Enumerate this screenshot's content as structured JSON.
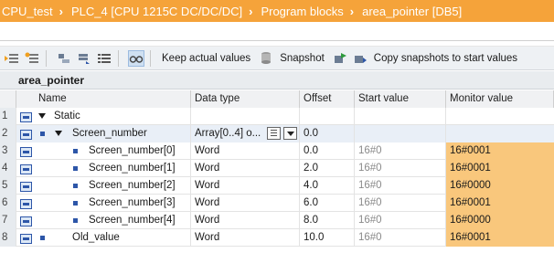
{
  "breadcrumb": [
    "CPU_test",
    "PLC_4 [CPU 1215C DC/DC/DC]",
    "Program blocks",
    "area_pointer [DB5]"
  ],
  "breadcrumb_separator": "›",
  "toolbar": {
    "keep_actual_values": "Keep actual values",
    "snapshot": "Snapshot",
    "copy_snapshots": "Copy snapshots to start values"
  },
  "block_title": "area_pointer",
  "columns": {
    "name": "Name",
    "data_type": "Data type",
    "offset": "Offset",
    "start_value": "Start value",
    "monitor_value": "Monitor value"
  },
  "rows": [
    {
      "num": "1",
      "name": "Static",
      "type": "",
      "offset": "",
      "start": "",
      "monitor": ""
    },
    {
      "num": "2",
      "name": "Screen_number",
      "type": "Array[0..4] o...",
      "offset": "0.0",
      "start": "",
      "monitor": ""
    },
    {
      "num": "3",
      "name": "Screen_number[0]",
      "type": "Word",
      "offset": "0.0",
      "start": "16#0",
      "monitor": "16#0001"
    },
    {
      "num": "4",
      "name": "Screen_number[1]",
      "type": "Word",
      "offset": "2.0",
      "start": "16#0",
      "monitor": "16#0001"
    },
    {
      "num": "5",
      "name": "Screen_number[2]",
      "type": "Word",
      "offset": "4.0",
      "start": "16#0",
      "monitor": "16#0000"
    },
    {
      "num": "6",
      "name": "Screen_number[3]",
      "type": "Word",
      "offset": "6.0",
      "start": "16#0",
      "monitor": "16#0001"
    },
    {
      "num": "7",
      "name": "Screen_number[4]",
      "type": "Word",
      "offset": "8.0",
      "start": "16#0",
      "monitor": "16#0000"
    },
    {
      "num": "8",
      "name": "Old_value",
      "type": "Word",
      "offset": "10.0",
      "start": "16#0",
      "monitor": "16#0001"
    }
  ],
  "colors": {
    "breadcrumb_bg": "#f5a33a",
    "monitor_highlight": "#f9c77c",
    "accent_blue": "#2d56a8"
  },
  "icons": [
    "insert-row-icon",
    "add-row-icon",
    "expand-icon",
    "collapse-icon",
    "list-view-icon",
    "monitor-glasses-icon",
    "keep-values-icon",
    "snapshot-icon",
    "copy-snapshot-icon",
    "copy-to-start-icon",
    "variable-icon"
  ]
}
